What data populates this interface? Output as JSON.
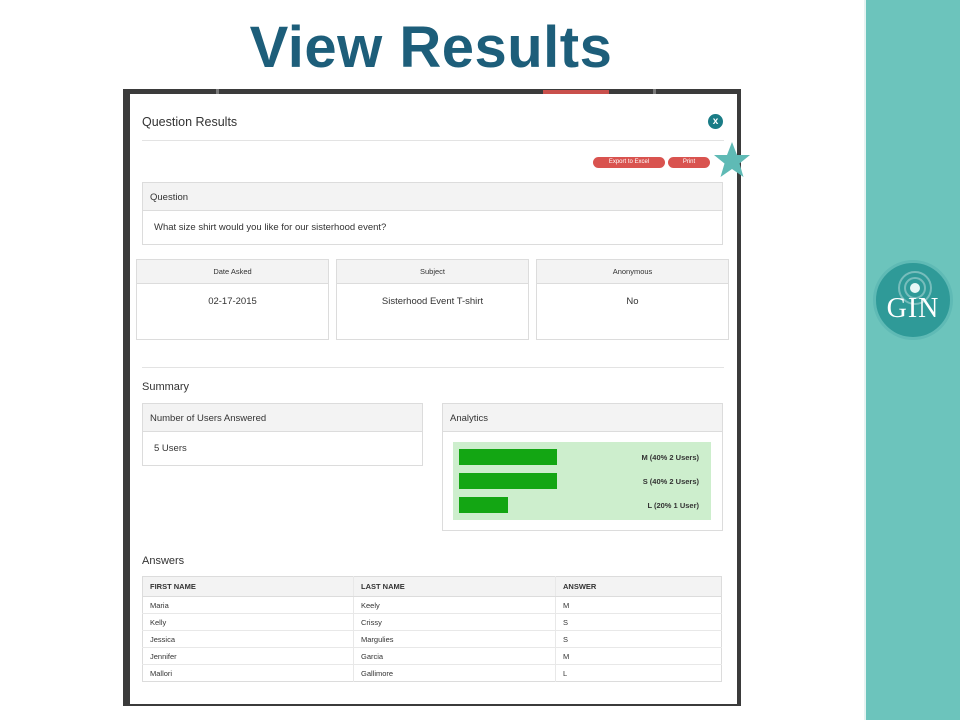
{
  "slide": {
    "title": "View Results",
    "logo_text": "GIN"
  },
  "modal": {
    "title": "Question Results",
    "close_label": "x",
    "actions": {
      "export_label": "Export to Excel",
      "print_label": "Print"
    },
    "question": {
      "header": "Question",
      "text": "What size shirt would you like for our sisterhood event?"
    },
    "info_cards": [
      {
        "label": "Date Asked",
        "value": "02-17-2015"
      },
      {
        "label": "Subject",
        "value": "Sisterhood Event T-shirt"
      },
      {
        "label": "Anonymous",
        "value": "No"
      }
    ],
    "summary": {
      "heading": "Summary",
      "users_header": "Number of Users Answered",
      "users_value": "5 Users"
    },
    "analytics": {
      "header": "Analytics",
      "bars": [
        {
          "label": "M (40% 2 Users)",
          "fraction": 0.4
        },
        {
          "label": "S (40% 2 Users)",
          "fraction": 0.4
        },
        {
          "label": "L (20% 1 User)",
          "fraction": 0.2
        }
      ],
      "bar_color": "#13a613",
      "area_color": "#cdeecd"
    },
    "answers": {
      "heading": "Answers",
      "columns": [
        "FIRST NAME",
        "LAST NAME",
        "ANSWER"
      ],
      "rows": [
        [
          "Maria",
          "Keely",
          "M"
        ],
        [
          "Kelly",
          "Crissy",
          "S"
        ],
        [
          "Jessica",
          "Margulies",
          "S"
        ],
        [
          "Jennifer",
          "Garcia",
          "M"
        ],
        [
          "Mallori",
          "Gallimore",
          "L"
        ]
      ]
    }
  },
  "colors": {
    "title": "#1d5e7a",
    "band": "#6cc4bc",
    "button": "#d9534f",
    "close": "#1a7c86",
    "star": "#5fbab5"
  },
  "icons": {
    "close": "close-icon",
    "star": "star-icon",
    "logo": "gin-logo"
  }
}
